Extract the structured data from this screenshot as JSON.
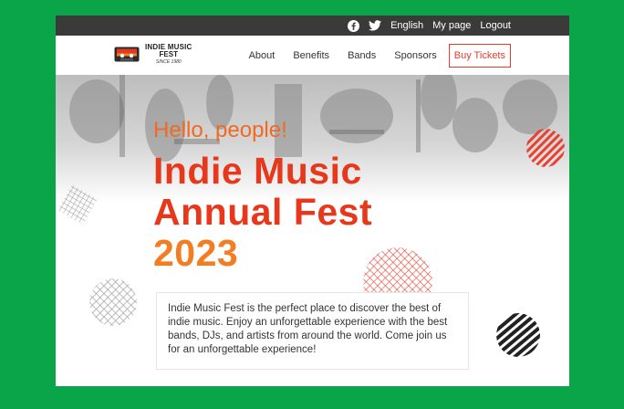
{
  "topbar": {
    "icons": [
      "facebook-icon",
      "twitter-icon"
    ],
    "language": "English",
    "mypage": "My page",
    "logout": "Logout"
  },
  "logo": {
    "line1": "INDIE MUSIC",
    "line2": "FEST",
    "line3": "SINCE 1980"
  },
  "nav": {
    "items": [
      {
        "label": "About"
      },
      {
        "label": "Benefits"
      },
      {
        "label": "Bands"
      },
      {
        "label": "Sponsors"
      }
    ],
    "cta": "Buy Tickets"
  },
  "hero": {
    "greeting": "Hello, people!",
    "title_line1": "Indie Music",
    "title_line2": "Annual Fest",
    "title_line3": "2023",
    "description": "Indie Music Fest is the perfect place to discover the best of indie music. Enjoy an unforgettable experience with the best bands, DJs, and artists from around the world. Come join us for an unforgettable experience!"
  },
  "colors": {
    "page_bg": "#0aa548",
    "topbar_bg": "#3a3a3a",
    "accent_red": "#e8381c",
    "accent_orange": "#f47d22",
    "cta_border": "#e53b2e"
  }
}
